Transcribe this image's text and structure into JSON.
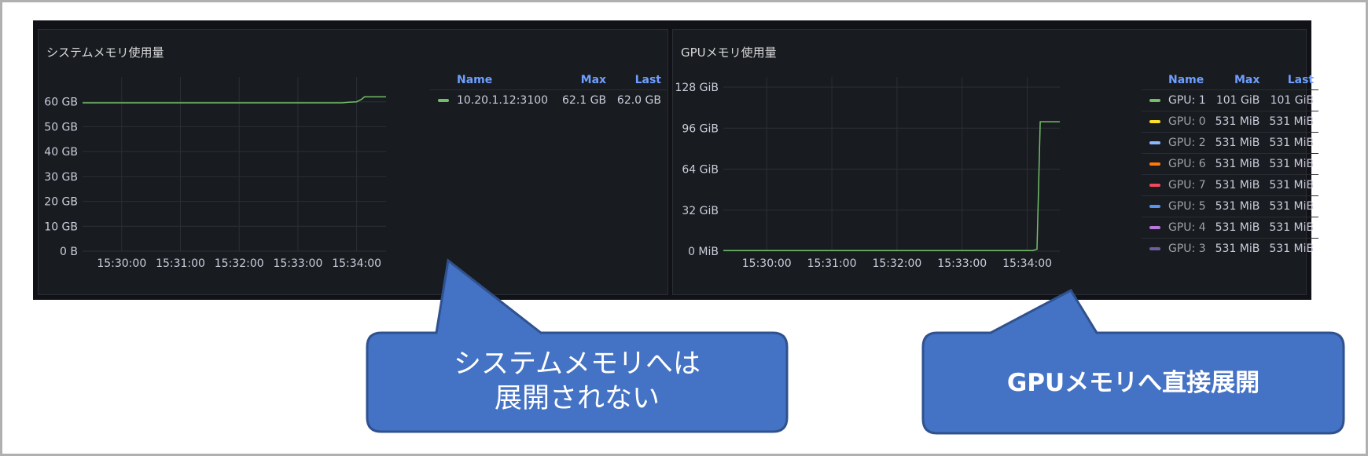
{
  "panels": {
    "system": {
      "title": "システムメモリ使用量",
      "legend_headers": {
        "name": "Name",
        "max": "Max",
        "last": "Last"
      },
      "legend": [
        {
          "name": "10.20.1.12:3100",
          "max": "62.1 GB",
          "last": "62.0 GB",
          "color": "#73bf69"
        }
      ]
    },
    "gpu": {
      "title": "GPUメモリ使用量",
      "legend_headers": {
        "name": "Name",
        "max": "Max",
        "last": "Last"
      },
      "legend": [
        {
          "name": "GPU: 1",
          "max": "101 GiB",
          "last": "101 GiB",
          "color": "#73bf69"
        },
        {
          "name": "GPU: 0",
          "max": "531 MiB",
          "last": "531 MiB",
          "color": "#fade2a"
        },
        {
          "name": "GPU: 2",
          "max": "531 MiB",
          "last": "531 MiB",
          "color": "#8ab8ff"
        },
        {
          "name": "GPU: 6",
          "max": "531 MiB",
          "last": "531 MiB",
          "color": "#ff780a"
        },
        {
          "name": "GPU: 7",
          "max": "531 MiB",
          "last": "531 MiB",
          "color": "#f2495c"
        },
        {
          "name": "GPU: 5",
          "max": "531 MiB",
          "last": "531 MiB",
          "color": "#5794f2"
        },
        {
          "name": "GPU: 4",
          "max": "531 MiB",
          "last": "531 MiB",
          "color": "#b877d9"
        },
        {
          "name": "GPU: 3",
          "max": "531 MiB",
          "last": "531 MiB",
          "color": "#705da0"
        }
      ]
    }
  },
  "chart_data": [
    {
      "type": "line",
      "title": "システムメモリ使用量",
      "y_unit": "GB",
      "ylim": [
        0,
        70
      ],
      "y_ticks": [
        {
          "value": 0,
          "label": "0 B"
        },
        {
          "value": 10,
          "label": "10 GB"
        },
        {
          "value": 20,
          "label": "20 GB"
        },
        {
          "value": 30,
          "label": "30 GB"
        },
        {
          "value": 40,
          "label": "40 GB"
        },
        {
          "value": 50,
          "label": "50 GB"
        },
        {
          "value": 60,
          "label": "60 GB"
        }
      ],
      "xlim": [
        "15:29:20",
        "15:34:30"
      ],
      "x_ticks": [
        "15:30:00",
        "15:31:00",
        "15:32:00",
        "15:33:00",
        "15:34:00"
      ],
      "grid": true,
      "series": [
        {
          "name": "10.20.1.12:3100",
          "color": "#73bf69",
          "x": [
            "15:29:20",
            "15:33:45",
            "15:33:52",
            "15:34:00",
            "15:34:05",
            "15:34:08",
            "15:34:30"
          ],
          "values": [
            59.6,
            59.6,
            59.8,
            60.0,
            61.0,
            62.0,
            62.0
          ]
        }
      ]
    },
    {
      "type": "line",
      "title": "GPUメモリ使用量",
      "y_unit": "GiB",
      "ylim": [
        0,
        136
      ],
      "y_ticks": [
        {
          "value": 0,
          "label": "0 MiB"
        },
        {
          "value": 32,
          "label": "32 GiB"
        },
        {
          "value": 64,
          "label": "64 GiB"
        },
        {
          "value": 96,
          "label": "96 GiB"
        },
        {
          "value": 128,
          "label": "128 GiB"
        }
      ],
      "xlim": [
        "15:29:20",
        "15:34:30"
      ],
      "x_ticks": [
        "15:30:00",
        "15:31:00",
        "15:32:00",
        "15:33:00",
        "15:34:00"
      ],
      "grid": true,
      "series": [
        {
          "name": "GPU: 1",
          "color": "#73bf69",
          "x": [
            "15:29:20",
            "15:34:05",
            "15:34:09",
            "15:34:12",
            "15:34:30"
          ],
          "values": [
            0.5,
            0.5,
            1.5,
            101,
            101
          ]
        }
      ]
    }
  ],
  "callouts": [
    {
      "text_line1": "システムメモリへは",
      "text_line2": "展開されない"
    },
    {
      "text": "GPUメモリへ直接展開"
    }
  ],
  "colors": {
    "callout_fill": "#4472c4",
    "callout_border": "#2f528f",
    "dashboard_bg": "#111217",
    "panel_bg": "#181b1f",
    "grid": "#2c2f35"
  }
}
